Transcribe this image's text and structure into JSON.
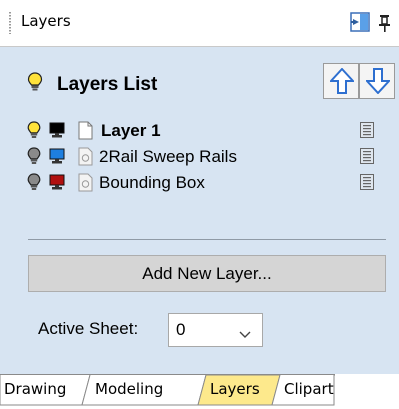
{
  "window": {
    "title": "Layers"
  },
  "header": {
    "title": "Layers List"
  },
  "layers": [
    {
      "name": "Layer 1",
      "active": true,
      "color": "#000000"
    },
    {
      "name": "2Rail Sweep Rails",
      "active": false,
      "color": "#1e7fe0"
    },
    {
      "name": "Bounding Box",
      "active": false,
      "color": "#b01010"
    }
  ],
  "actions": {
    "add_layer_label": "Add New Layer..."
  },
  "active_sheet": {
    "label": "Active Sheet:",
    "value": "0"
  },
  "tabs": [
    {
      "label": "Drawing",
      "selected": false
    },
    {
      "label": "Modeling",
      "selected": false
    },
    {
      "label": "Layers",
      "selected": true
    },
    {
      "label": "Clipart",
      "selected": false
    }
  ],
  "colors": {
    "panel_bg": "#d7e4f2",
    "selected_tab": "#fde98c",
    "arrow_blue": "#2e6fd0"
  }
}
